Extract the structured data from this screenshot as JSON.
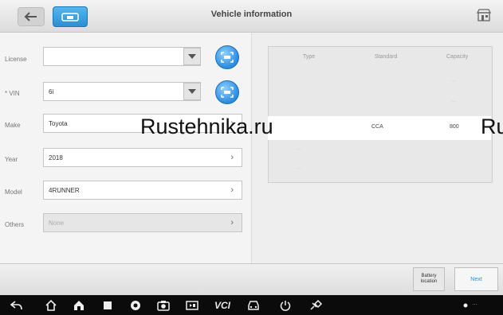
{
  "header": {
    "title": "Vehicle information"
  },
  "form": {
    "license": {
      "label": "License",
      "value": ""
    },
    "vin": {
      "label": "* VIN",
      "value": "6i"
    },
    "make": {
      "label": "Make",
      "value": "Toyota"
    },
    "year": {
      "label": "Year",
      "value": "2018"
    },
    "model": {
      "label": "Model",
      "value": "4RUNNER"
    },
    "others": {
      "label": "Others",
      "value": "None"
    }
  },
  "battery_table": {
    "headers": [
      "Type",
      "Standard",
      "Capacity"
    ],
    "selected_row": {
      "standard": "CCA",
      "capacity": "800"
    }
  },
  "actions": {
    "battery_location": "Battery location",
    "next": "Next"
  },
  "watermark": {
    "left_text": "Rustehnika.ru",
    "right_text": "Ru"
  },
  "colors": {
    "accent": "#2d8cd6",
    "scan_button": "#2a8be0"
  }
}
